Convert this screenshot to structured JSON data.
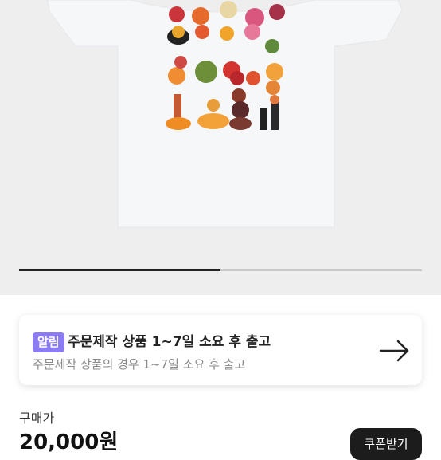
{
  "gallery": {
    "progress": 0.5
  },
  "notice": {
    "badge": "알림",
    "title": "주문제작 상품 1~7일 소요 후 출고",
    "description": "주문제작 상품의 경우  1~7일 소요 후 출고",
    "arrow_icon": "arrow-right-icon"
  },
  "price": {
    "label": "구매가",
    "value": "20,000원"
  },
  "coupon_button": {
    "label": "쿠폰받기"
  }
}
